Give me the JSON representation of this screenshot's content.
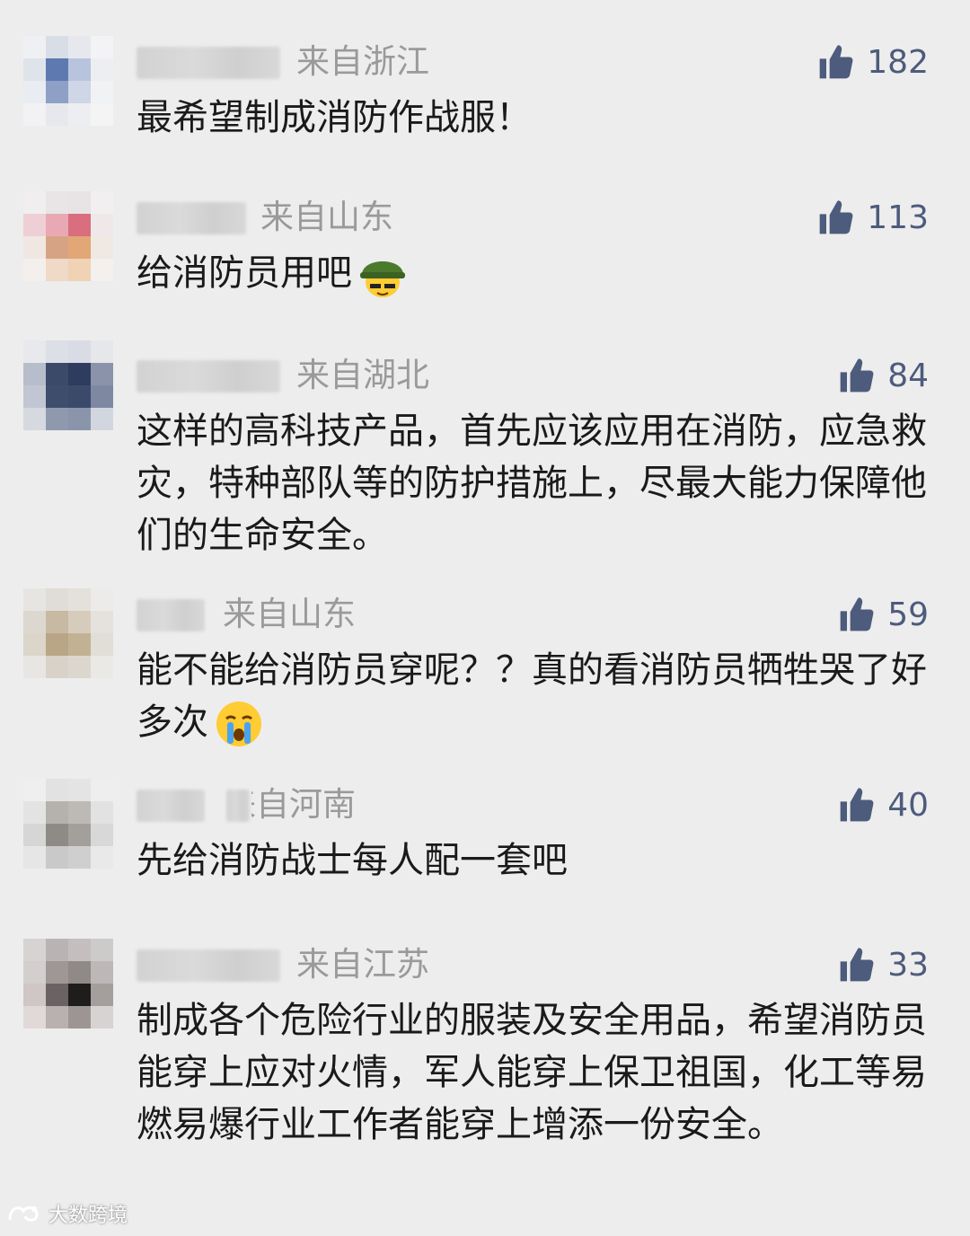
{
  "comments": [
    {
      "region": "来自浙江",
      "likes": "182",
      "text": "最希望制成消防作战服！",
      "emoji": "",
      "avatar": [
        "#eef0f4",
        "#d9dde6",
        "#e6e8ee",
        "#f3f3f5",
        "#dfe3ea",
        "#5d79b0",
        "#b8c4de",
        "#eceef2",
        "#e9ecf1",
        "#8ea0c6",
        "#cfd6e6",
        "#f1f2f4",
        "#f2f2f4",
        "#e6e8ed",
        "#eceef1",
        "#f4f4f5"
      ]
    },
    {
      "region": "来自山东",
      "likes": "113",
      "text": "给消防员用吧",
      "emoji": "helmet-emoji",
      "avatar": [
        "#f0eeee",
        "#e9e5e6",
        "#e8e3e4",
        "#f1efef",
        "#eecfd5",
        "#e8a9b4",
        "#d86e7e",
        "#efe8e9",
        "#f0e7e2",
        "#d7a385",
        "#e2a677",
        "#efe8e3",
        "#f3efec",
        "#efd9c7",
        "#f0d2b4",
        "#f3f0ee"
      ]
    },
    {
      "region": "来自湖北",
      "likes": "84",
      "text": "这样的高科技产品，首先应该应用在消防，应急救灾，特种部队等的防护措施上，尽最大能力保障他们的生命安全。",
      "emoji": "",
      "avatar": [
        "#e8e9ed",
        "#dcdfe6",
        "#d9dce4",
        "#e5e7ea",
        "#b7bdcb",
        "#3c4a6a",
        "#2e3d5f",
        "#8a93a9",
        "#c1c6d2",
        "#3f4d6d",
        "#3b4a6b",
        "#7e89a1",
        "#d6d9e0",
        "#8f99ae",
        "#8a94aa",
        "#d2d6de"
      ]
    },
    {
      "region": "来自山东",
      "likes": "59",
      "text": "能不能给消防员穿呢？？真的看消防员牺牲哭了好多次",
      "emoji": "crying-emoji",
      "avatar": [
        "#e7e5e2",
        "#e0ddd8",
        "#e4e1dc",
        "#ecebe9",
        "#ddd8cf",
        "#c8b9a2",
        "#d7ccbb",
        "#e5e2de",
        "#dcd5ca",
        "#b9a686",
        "#c3b194",
        "#e1ddd7",
        "#e8e6e3",
        "#d8d2c8",
        "#dcd7ce",
        "#ebe9e6"
      ]
    },
    {
      "region": "来自河南",
      "likes": "40",
      "text": "先给消防战士每人配一套吧",
      "emoji": "",
      "avatar": [
        "#efefef",
        "#e2e2e2",
        "#e4e4e4",
        "#eeeeee",
        "#e3e3e3",
        "#b5b2ae",
        "#bdbab6",
        "#e2e2e2",
        "#d6d6d6",
        "#8e8b87",
        "#a3a09c",
        "#d8d8d8",
        "#e6e6e6",
        "#c9c9c9",
        "#cfcfcf",
        "#e9e9e9"
      ]
    },
    {
      "region": "来自江苏",
      "likes": "33",
      "text": "制成各个危险行业的服装及安全用品，希望消防员能穿上应对火情，军人能穿上保卫祖国，化工等易燃易爆行业工作者能穿上增添一份安全。",
      "emoji": "",
      "avatar": [
        "#d6d3d2",
        "#b9b4b3",
        "#c4bfbe",
        "#cdcaca",
        "#d3cfcf",
        "#9e9796",
        "#8f8988",
        "#bdb8b7",
        "#cfc6c5",
        "#6b6363",
        "#1f1c1c",
        "#a49e9d",
        "#e0d9d8",
        "#b8b1b0",
        "#9c9594",
        "#d7d3d2"
      ]
    }
  ],
  "watermark": {
    "text": "大数跨境"
  },
  "colors": {
    "background": "#ededed",
    "like_icon": "#4d5b7c",
    "region_text": "#9a9a9a",
    "body_text": "#1a1a1a"
  }
}
